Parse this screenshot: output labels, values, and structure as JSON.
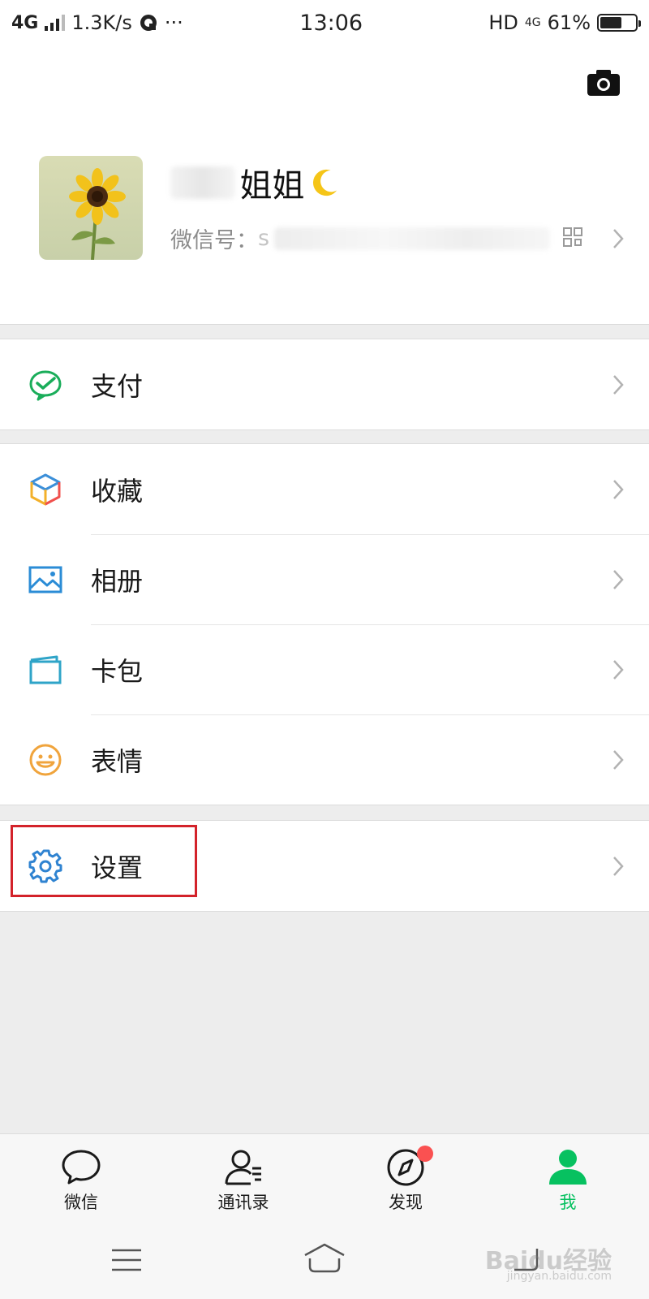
{
  "status_bar": {
    "network": "4G",
    "speed": "1.3K/s",
    "more": "···",
    "time": "13:06",
    "hd": "HD",
    "net_right": "4G",
    "battery_text": "61%",
    "battery_level": 0.61
  },
  "profile": {
    "nickname_visible": "姐姐",
    "nickname_prefix": "..",
    "id_label": "微信号：",
    "id_value_visible": "s"
  },
  "menu": {
    "pay": "支付",
    "favorites": "收藏",
    "album": "相册",
    "cards": "卡包",
    "stickers": "表情",
    "settings": "设置"
  },
  "tabs": [
    {
      "label": "微信",
      "icon": "chat-bubble-icon"
    },
    {
      "label": "通讯录",
      "icon": "contacts-icon"
    },
    {
      "label": "发现",
      "icon": "compass-icon",
      "badge": true
    },
    {
      "label": "我",
      "icon": "person-icon",
      "active": true
    }
  ],
  "watermark": {
    "text": "Baidu经验",
    "sub": "jingyan.baidu.com"
  },
  "colors": {
    "accent": "#07c160",
    "badge": "#fa5151",
    "highlight": "#d3222a"
  }
}
